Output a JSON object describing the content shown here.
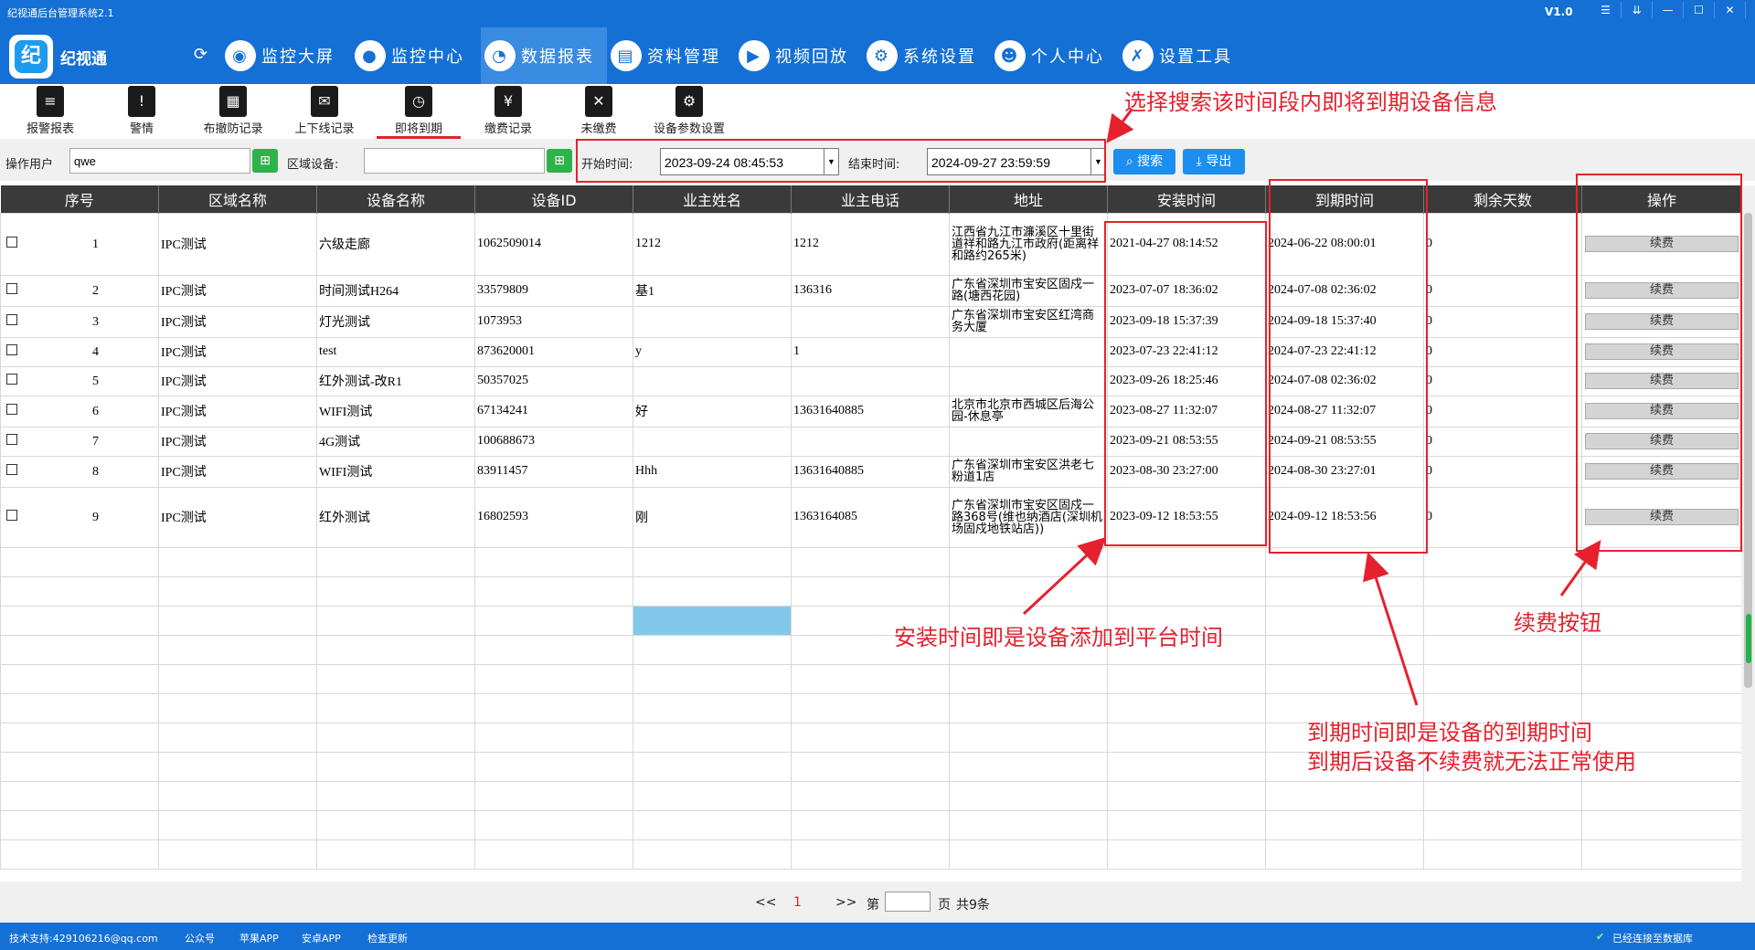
{
  "window": {
    "title": "纪视通后台管理系统2.1",
    "version": "V1.0",
    "controls": [
      "☰",
      "⇊",
      "—",
      "☐",
      "✕"
    ]
  },
  "app": {
    "name": "纪视通",
    "logo_letter": "纪"
  },
  "main_nav": [
    {
      "label": "监控大屏",
      "icon": "camera-icon"
    },
    {
      "label": "监控中心",
      "icon": "webcam-icon"
    },
    {
      "label": "数据报表",
      "icon": "pie-chart-icon"
    },
    {
      "label": "资料管理",
      "icon": "database-icon"
    },
    {
      "label": "视频回放",
      "icon": "play-icon"
    },
    {
      "label": "系统设置",
      "icon": "gear-icon"
    },
    {
      "label": "个人中心",
      "icon": "user-icon"
    },
    {
      "label": "设置工具",
      "icon": "tools-icon"
    }
  ],
  "sub_toolbar": [
    {
      "label": "报警报表",
      "glyph": "≡"
    },
    {
      "label": "警情",
      "glyph": "!"
    },
    {
      "label": "布撤防记录",
      "glyph": "▦"
    },
    {
      "label": "上下线记录",
      "glyph": "✉"
    },
    {
      "label": "即将到期",
      "glyph": "◷"
    },
    {
      "label": "缴费记录",
      "glyph": "¥"
    },
    {
      "label": "未缴费",
      "glyph": "✕"
    },
    {
      "label": "设备参数设置",
      "glyph": "⚙"
    }
  ],
  "filter": {
    "operator_label": "操作用户",
    "operator_value": "qwe",
    "area_label": "区域设备:",
    "area_value": "",
    "start_label": "开始时间:",
    "start_value": "2023-09-24 08:45:53",
    "end_label": "结束时间:",
    "end_value": "2024-09-27 23:59:59",
    "search_label": "搜索",
    "export_label": "导出"
  },
  "table": {
    "columns": [
      "序号",
      "区域名称",
      "设备名称",
      "设备ID",
      "业主姓名",
      "业主电话",
      "地址",
      "安装时间",
      "到期时间",
      "剩余天数",
      "操作"
    ],
    "renew_label": "续费",
    "rows": [
      {
        "no": "1",
        "area": "IPC测试",
        "name": "六级走廊",
        "id": "1062509014",
        "owner": "1212",
        "phone": "1212",
        "address": "江西省九江市濂溪区十里街道祥和路九江市政府(距离祥和路约265米)",
        "install": "2021-04-27 08:14:52",
        "expire": "2024-06-22 08:00:01",
        "days": "0"
      },
      {
        "no": "2",
        "area": "IPC测试",
        "name": "时间测试H264",
        "id": "33579809",
        "owner": "基1",
        "phone": "136316",
        "address": "广东省深圳市宝安区固戍一路(塘西花园)",
        "install": "2023-07-07 18:36:02",
        "expire": "2024-07-08 02:36:02",
        "days": "0"
      },
      {
        "no": "3",
        "area": "IPC测试",
        "name": "灯光测试",
        "id": "1073953",
        "owner": "",
        "phone": "",
        "address": "广东省深圳市宝安区红湾商务大厦",
        "install": "2023-09-18 15:37:39",
        "expire": "2024-09-18 15:37:40",
        "days": "0"
      },
      {
        "no": "4",
        "area": "IPC测试",
        "name": "test",
        "id": "873620001",
        "owner": "y",
        "phone": "1",
        "address": "",
        "install": "2023-07-23 22:41:12",
        "expire": "2024-07-23 22:41:12",
        "days": "0"
      },
      {
        "no": "5",
        "area": "IPC测试",
        "name": "红外测试-改R1",
        "id": "50357025",
        "owner": "",
        "phone": "",
        "address": "",
        "install": "2023-09-26 18:25:46",
        "expire": "2024-07-08 02:36:02",
        "days": "0"
      },
      {
        "no": "6",
        "area": "IPC测试",
        "name": "WIFI测试",
        "id": "67134241",
        "owner": "好",
        "phone": "13631640885",
        "address": "北京市北京市西城区后海公园-休息亭",
        "install": "2023-08-27 11:32:07",
        "expire": "2024-08-27 11:32:07",
        "days": "0"
      },
      {
        "no": "7",
        "area": "IPC测试",
        "name": "4G测试",
        "id": "100688673",
        "owner": "",
        "phone": "",
        "address": "",
        "install": "2023-09-21 08:53:55",
        "expire": "2024-09-21 08:53:55",
        "days": "0"
      },
      {
        "no": "8",
        "area": "IPC测试",
        "name": "WIFI测试",
        "id": "83911457",
        "owner": "Hhh",
        "phone": "13631640885",
        "address": "广东省深圳市宝安区洪老七粉道1店",
        "install": "2023-08-30 23:27:00",
        "expire": "2024-08-30 23:27:01",
        "days": "0"
      },
      {
        "no": "9",
        "area": "IPC测试",
        "name": "红外测试",
        "id": "16802593",
        "owner": "刚",
        "phone": "1363164085",
        "address": "广东省深圳市宝安区固戍一路368号(维也纳酒店(深圳机场固戍地铁站店))",
        "install": "2023-09-12 18:53:55",
        "expire": "2024-09-12 18:53:56",
        "days": "0"
      }
    ]
  },
  "pager": {
    "prev": "<<",
    "current": "1",
    "next": ">>",
    "page_prefix": "第",
    "page_suffix": "页",
    "total": "共9条"
  },
  "status_bar": {
    "support": "技术支持:429106216@qq.com",
    "wechat": "公众号",
    "apple": "苹果APP",
    "android": "安卓APP",
    "update": "检查更新",
    "db_status": "已经连接至数据库"
  },
  "annotations": {
    "search_tip": "选择搜索该时间段内即将到期设备信息",
    "install_tip": "安装时间即是设备添加到平台时间",
    "expire_tip_1": "到期时间即是设备的到期时间",
    "expire_tip_2": "到期后设备不续费就无法正常使用",
    "renew_tip": "续费按钮"
  },
  "colors": {
    "brand_blue": "#1570d6",
    "annotation_red": "#e6212e",
    "header_dark": "#3a3a3a",
    "green_button": "#2db34a"
  }
}
